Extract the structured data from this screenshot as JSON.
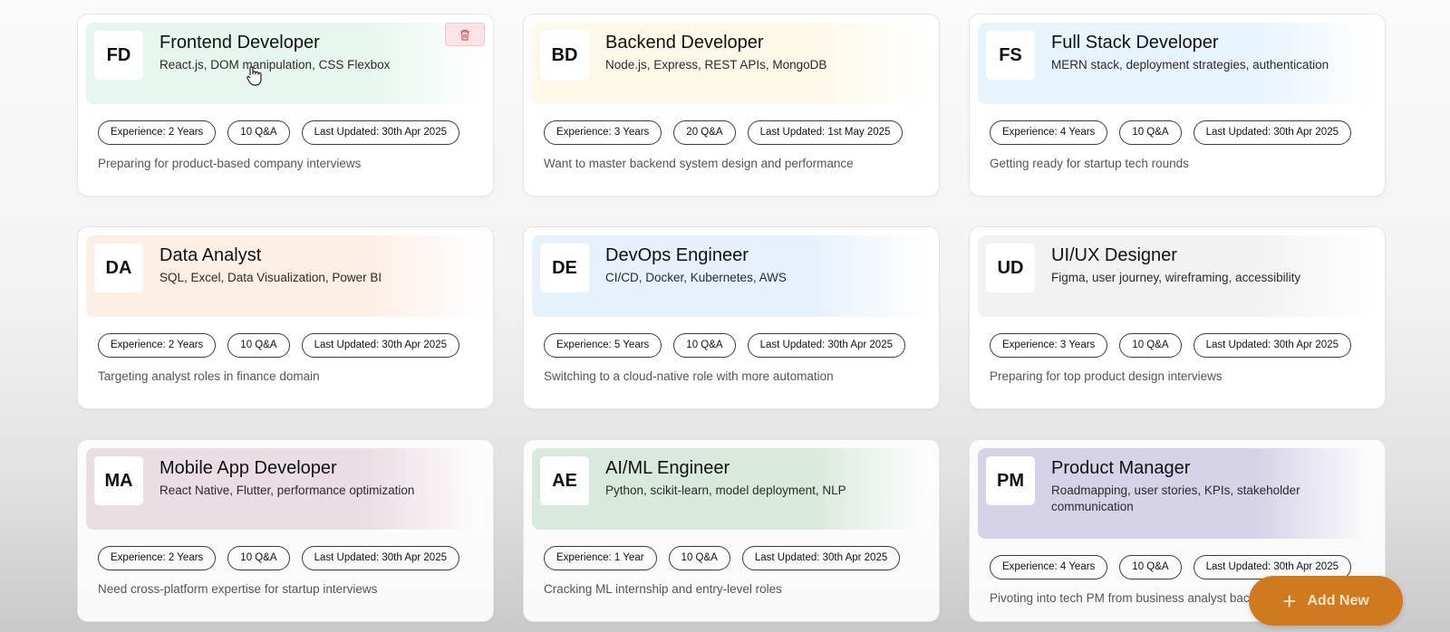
{
  "cards": [
    {
      "initials": "FD",
      "title": "Frontend Developer",
      "skills": "React.js, DOM manipulation, CSS Flexbox",
      "experience": "Experience: 2 Years",
      "qa": "10 Q&A",
      "updated": "Last Updated: 30th Apr 2025",
      "description": "Preparing for product-based company interviews",
      "header_color": "#e6f6ee"
    },
    {
      "initials": "BD",
      "title": "Backend Developer",
      "skills": "Node.js, Express, REST APIs, MongoDB",
      "experience": "Experience: 3 Years",
      "qa": "20 Q&A",
      "updated": "Last Updated: 1st May 2025",
      "description": "Want to master backend system design and performance",
      "header_color": "#fef8e8"
    },
    {
      "initials": "FS",
      "title": "Full Stack Developer",
      "skills": "MERN stack, deployment strategies, authentication",
      "experience": "Experience: 4 Years",
      "qa": "10 Q&A",
      "updated": "Last Updated: 30th Apr 2025",
      "description": "Getting ready for startup tech rounds",
      "header_color": "#e8f4fd"
    },
    {
      "initials": "DA",
      "title": "Data Analyst",
      "skills": "SQL, Excel, Data Visualization, Power BI",
      "experience": "Experience: 2 Years",
      "qa": "10 Q&A",
      "updated": "Last Updated: 30th Apr 2025",
      "description": "Targeting analyst roles in finance domain",
      "header_color": "#fdeee6"
    },
    {
      "initials": "DE",
      "title": "DevOps Engineer",
      "skills": "CI/CD, Docker, Kubernetes, AWS",
      "experience": "Experience: 5 Years",
      "qa": "10 Q&A",
      "updated": "Last Updated: 30th Apr 2025",
      "description": "Switching to a cloud-native role with more automation",
      "header_color": "#e6f1fb"
    },
    {
      "initials": "UD",
      "title": "UI/UX Designer",
      "skills": "Figma, user journey, wireframing, accessibility",
      "experience": "Experience: 3 Years",
      "qa": "10 Q&A",
      "updated": "Last Updated: 30th Apr 2025",
      "description": "Preparing for top product design interviews",
      "header_color": "#f2f2f3"
    },
    {
      "initials": "MA",
      "title": "Mobile App Developer",
      "skills": "React Native, Flutter, performance optimization",
      "experience": "Experience: 2 Years",
      "qa": "10 Q&A",
      "updated": "Last Updated: 30th Apr 2025",
      "description": "Need cross-platform expertise for startup interviews",
      "header_color": "#ebdde4"
    },
    {
      "initials": "AE",
      "title": "AI/ML Engineer",
      "skills": "Python, scikit-learn, model deployment, NLP",
      "experience": "Experience: 1 Year",
      "qa": "10 Q&A",
      "updated": "Last Updated: 30th Apr 2025",
      "description": "Cracking ML internship and entry-level roles",
      "header_color": "#d9e9dd"
    },
    {
      "initials": "PM",
      "title": "Product Manager",
      "skills": "Roadmapping, user stories, KPIs, stakeholder communication",
      "experience": "Experience: 4 Years",
      "qa": "10 Q&A",
      "updated": "Last Updated: 30th Apr 2025",
      "description": "Pivoting into tech PM from business analyst back",
      "header_color": "#d6d3e8"
    }
  ],
  "add_button": {
    "label": "Add New",
    "color": "#cf7a1f"
  },
  "icons": {
    "delete": "trash-icon",
    "add": "plus-icon",
    "cursor": "hand-cursor-icon"
  }
}
